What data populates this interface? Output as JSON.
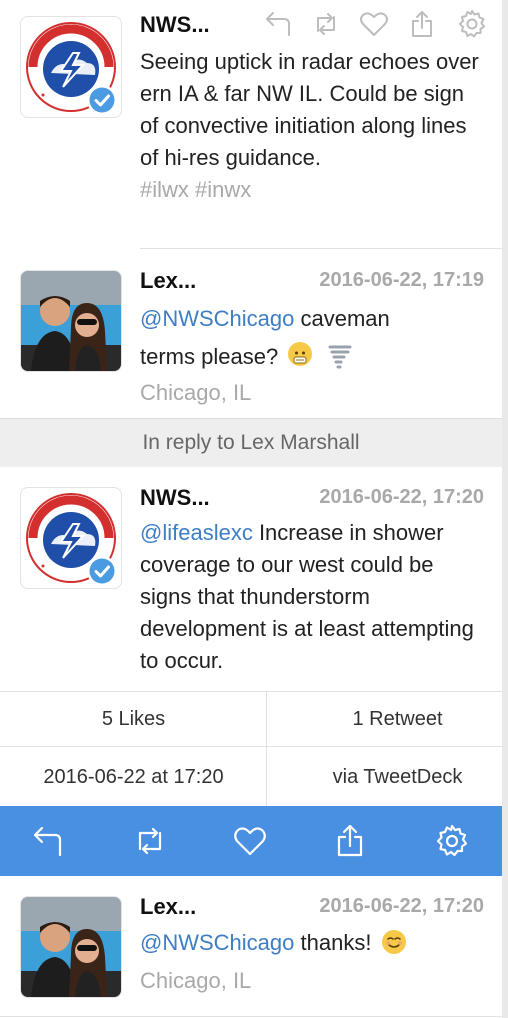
{
  "tweet1": {
    "name": "NWS...",
    "text": "Seeing uptick in radar echoes over ern IA & far NW IL. Could be sign of convective initiation along lines of hi-res guidance.",
    "hashtags": "#ilwx #inwx",
    "avatar_text": "NATIONAL WEATHER SERVICE"
  },
  "tweet2": {
    "name": "Lex...",
    "time": "2016-06-22, 17:19",
    "mention": "@NWSChicago",
    "text_line1": " caveman",
    "text_line2": "terms please?",
    "location": "Chicago, IL"
  },
  "reply_banner": "In reply to Lex Marshall",
  "tweet3": {
    "name": "NWS...",
    "time": "2016-06-22, 17:20",
    "mention": "@lifeaslexc",
    "text": " Increase in shower coverage to our west could be signs that thunderstorm development is at least attempting to occur."
  },
  "stats": {
    "likes": "5 Likes",
    "retweets": "1 Retweet",
    "date": "2016-06-22 at 17:20",
    "via": "via TweetDeck"
  },
  "tweet4": {
    "name": "Lex...",
    "time": "2016-06-22, 17:20",
    "mention": "@NWSChicago",
    "text": " thanks!",
    "location": "Chicago, IL"
  },
  "colors": {
    "accent": "#4a90e2",
    "mention": "#3d7ec5",
    "muted": "#a9a9a9"
  },
  "icons": [
    "reply-icon",
    "retweet-icon",
    "like-icon",
    "share-icon",
    "settings-icon",
    "verified-icon"
  ]
}
